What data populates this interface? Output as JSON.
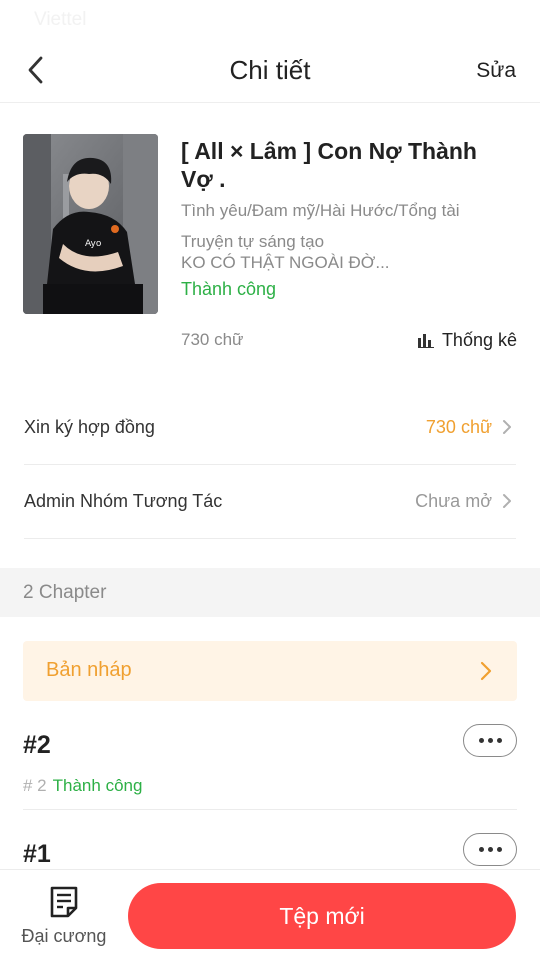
{
  "status_bar": {
    "carrier": "Viettel"
  },
  "nav": {
    "title": "Chi tiết",
    "edit_label": "Sửa",
    "back_icon": "chevron-left-icon"
  },
  "book": {
    "title": "[ All × Lâm ] Con Nợ Thành Vợ .",
    "genres": "Tình yêu/Đam mỹ/Hài Hước/Tổng tài",
    "desc_line1": "Truyện tự sáng tạo",
    "desc_line2": "KO CÓ THẬT NGOÀI ĐỜ...",
    "status": "Thành công",
    "word_count": "730 chữ",
    "stats_label": "Thống kê",
    "stats_icon": "bar-chart-icon"
  },
  "settings": [
    {
      "label": "Xin ký hợp đồng",
      "value": "730 chữ",
      "value_color": "#f0a030"
    },
    {
      "label": "Admin Nhóm Tương Tác",
      "value": "Chưa mở",
      "value_color": "#999999"
    }
  ],
  "chapters_header": "2 Chapter",
  "draft": {
    "label": "Bản nháp"
  },
  "chapters": [
    {
      "title": "#2",
      "number": "# 2",
      "status": "Thành công"
    },
    {
      "title": "#1"
    }
  ],
  "bottom_bar": {
    "outline_label": "Đại cương",
    "outline_icon": "document-icon",
    "new_file_label": "Tệp mới"
  },
  "colors": {
    "accent": "#ff4646",
    "success": "#2db046",
    "warning": "#f0a030",
    "draft_bg": "#fff4e6"
  }
}
